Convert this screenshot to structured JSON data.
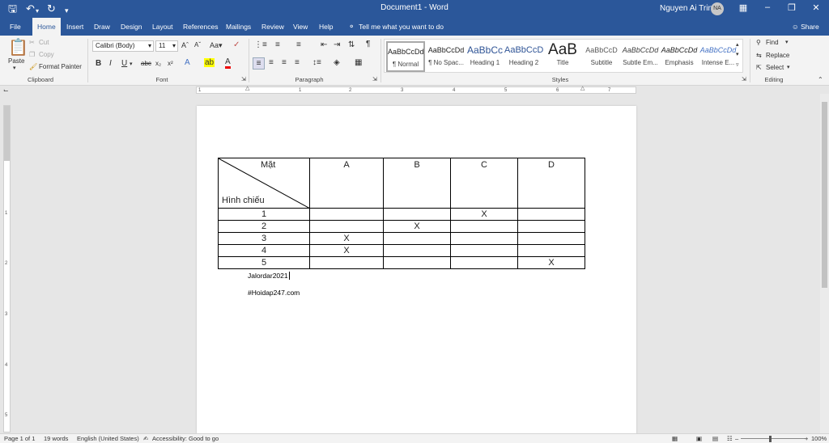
{
  "window": {
    "title": "Document1 - Word",
    "user": "Nguyen Ai Trinh",
    "avatar_initials": "NA"
  },
  "tabs": [
    "File",
    "Home",
    "Insert",
    "Draw",
    "Design",
    "Layout",
    "References",
    "Mailings",
    "Review",
    "View",
    "Help"
  ],
  "active_tab": "Home",
  "tell_me": "Tell me what you want to do",
  "share": "Share",
  "clipboard": {
    "paste": "Paste",
    "cut": "Cut",
    "copy": "Copy",
    "format_painter": "Format Painter",
    "label": "Clipboard"
  },
  "font": {
    "name": "Calibri (Body)",
    "size": "11",
    "label": "Font"
  },
  "paragraph": {
    "label": "Paragraph"
  },
  "styles": {
    "label": "Styles",
    "items": [
      {
        "preview": "AaBbCcDd",
        "name": "¶ Normal"
      },
      {
        "preview": "AaBbCcDd",
        "name": "¶ No Spac..."
      },
      {
        "preview": "AaBbCc",
        "name": "Heading 1"
      },
      {
        "preview": "AaBbCcD",
        "name": "Heading 2"
      },
      {
        "preview": "AaB",
        "name": "Title"
      },
      {
        "preview": "AaBbCcD",
        "name": "Subtitle"
      },
      {
        "preview": "AaBbCcDd",
        "name": "Subtle Em..."
      },
      {
        "preview": "AaBbCcDd",
        "name": "Emphasis"
      },
      {
        "preview": "AaBbCcDd",
        "name": "Intense E..."
      }
    ]
  },
  "editing": {
    "find": "Find",
    "replace": "Replace",
    "select": "Select",
    "label": "Editing"
  },
  "ruler_numbers": [
    "1",
    "1",
    "2",
    "3",
    "4",
    "5",
    "6",
    "7"
  ],
  "vruler_numbers": [
    "1",
    "2",
    "3",
    "4",
    "5"
  ],
  "document": {
    "table": {
      "corner_top": "Mặt",
      "corner_bottom": "Hình chiếu",
      "columns": [
        "A",
        "B",
        "C",
        "D"
      ],
      "rows": [
        {
          "label": "1",
          "cells": [
            "",
            "",
            "X",
            ""
          ]
        },
        {
          "label": "2",
          "cells": [
            "",
            "X",
            "",
            ""
          ]
        },
        {
          "label": "3",
          "cells": [
            "X",
            "",
            "",
            ""
          ]
        },
        {
          "label": "4",
          "cells": [
            "X",
            "",
            "",
            ""
          ]
        },
        {
          "label": "5",
          "cells": [
            "",
            "",
            "",
            "X"
          ]
        }
      ]
    },
    "line1": "Jalordar2021",
    "line2": "#Hoidap247.com"
  },
  "status": {
    "page": "Page 1 of 1",
    "words": "19 words",
    "language": "English (United States)",
    "accessibility": "Accessibility: Good to go",
    "zoom": "100%"
  }
}
